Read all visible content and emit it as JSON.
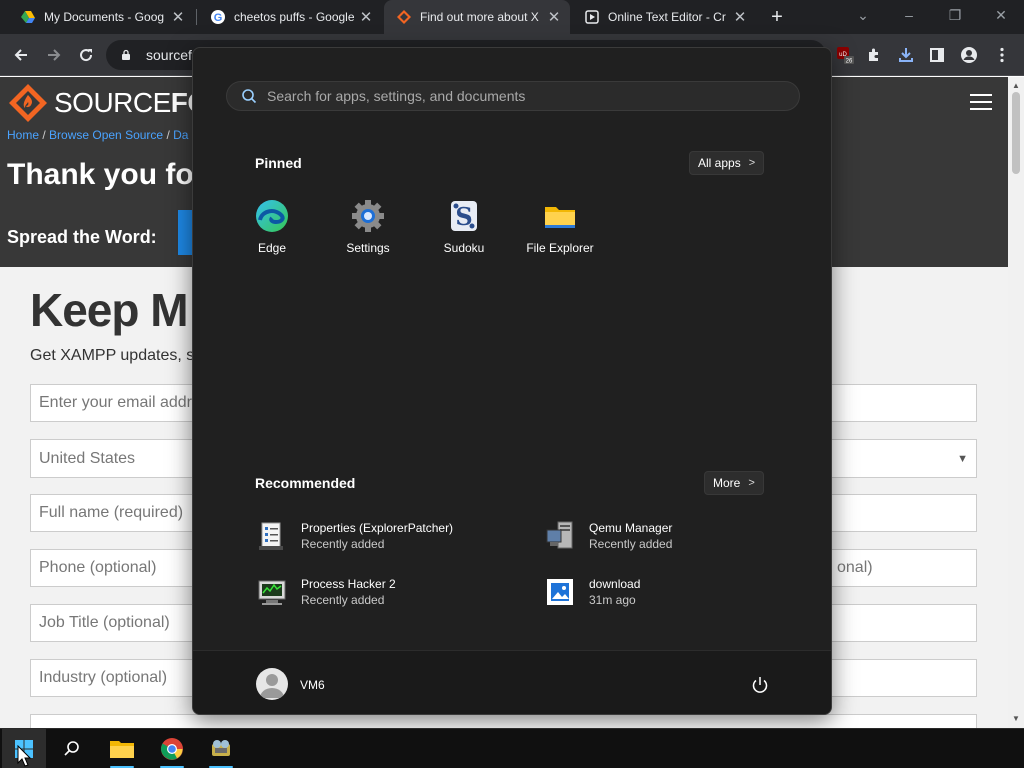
{
  "browser": {
    "tabs": [
      {
        "title": "My Documents - Goog",
        "icon": "google-drive-icon"
      },
      {
        "title": "cheetos puffs - Google",
        "icon": "google-icon"
      },
      {
        "title": "Find out more about X",
        "icon": "sourceforge-icon"
      },
      {
        "title": "Online Text Editor - Cr",
        "icon": "text-editor-icon"
      }
    ],
    "new_tab_label": "+",
    "address": "sourcefo",
    "extension_badge_text": "26"
  },
  "page": {
    "logo_text_light": "SOURCE",
    "logo_text_bold": "FOR",
    "breadcrumbs": [
      "Home",
      "Browse Open Source",
      "Da"
    ],
    "thank_you": "Thank you fo",
    "spread": "Spread the Word:",
    "keep": "Keep M",
    "get_updates": "Get XAMPP updates, s",
    "fields": [
      {
        "placeholder": "Enter your email addre",
        "right": ""
      },
      {
        "placeholder": "United States",
        "right": "",
        "dropdown": true
      },
      {
        "placeholder": "Full name (required)",
        "right": ""
      },
      {
        "placeholder": "Phone  (optional)",
        "right": "onal)"
      },
      {
        "placeholder": "Job Title  (optional)",
        "right": ""
      },
      {
        "placeholder": "Industry  (optional)",
        "right": ""
      }
    ]
  },
  "start_menu": {
    "search_placeholder": "Search for apps, settings, and documents",
    "pinned_title": "Pinned",
    "all_apps_label": "All apps",
    "pinned": [
      {
        "label": "Edge",
        "icon": "edge-icon"
      },
      {
        "label": "Settings",
        "icon": "settings-gear-icon"
      },
      {
        "label": "Sudoku",
        "icon": "sudoku-icon"
      },
      {
        "label": "File Explorer",
        "icon": "folder-icon"
      }
    ],
    "recommended_title": "Recommended",
    "more_label": "More",
    "recommended": [
      {
        "name": "Properties (ExplorerPatcher)",
        "sub": "Recently added",
        "icon": "properties-icon"
      },
      {
        "name": "Qemu Manager",
        "sub": "Recently added",
        "icon": "qemu-manager-icon"
      },
      {
        "name": "Process Hacker 2",
        "sub": "Recently added",
        "icon": "process-hacker-icon"
      },
      {
        "name": "download",
        "sub": "31m ago",
        "icon": "image-file-icon"
      }
    ],
    "user": "VM6"
  },
  "taskbar": {
    "items": [
      "start-icon",
      "search-icon",
      "file-explorer-icon",
      "chrome-icon",
      "app-icon"
    ]
  },
  "colors": {
    "start_bg": "#202020",
    "taskbar_bg": "#101010",
    "accent": "#4cc2ff",
    "sf_orange": "#f26522"
  }
}
